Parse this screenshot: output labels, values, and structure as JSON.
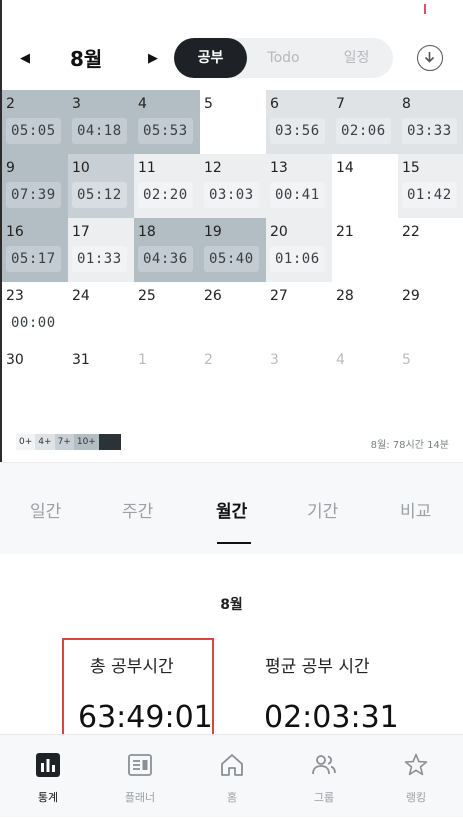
{
  "header": {
    "month_title": "8월",
    "prev_arrow": "◀",
    "next_arrow": "▶",
    "segments": [
      "공부",
      "Todo",
      "일정"
    ],
    "active_segment": "공부"
  },
  "calendar": {
    "weeks": [
      [
        {
          "num": "2",
          "time": "05:05",
          "level": 4
        },
        {
          "num": "3",
          "time": "04:18",
          "level": 4
        },
        {
          "num": "4",
          "time": "05:53",
          "level": 4
        },
        {
          "num": "5",
          "time": "",
          "level": 0
        },
        {
          "num": "6",
          "time": "03:56",
          "level": 2
        },
        {
          "num": "7",
          "time": "02:06",
          "level": 2
        },
        {
          "num": "8",
          "time": "03:33",
          "level": 2
        }
      ],
      [
        {
          "num": "9",
          "time": "07:39",
          "level": 4
        },
        {
          "num": "10",
          "time": "05:12",
          "level": 3
        },
        {
          "num": "11",
          "time": "02:20",
          "level": 1
        },
        {
          "num": "12",
          "time": "03:03",
          "level": 1
        },
        {
          "num": "13",
          "time": "00:41",
          "level": 1
        },
        {
          "num": "14",
          "time": "",
          "level": 0
        },
        {
          "num": "15",
          "time": "01:42",
          "level": 1
        }
      ],
      [
        {
          "num": "16",
          "time": "05:17",
          "level": 4
        },
        {
          "num": "17",
          "time": "01:33",
          "level": 1
        },
        {
          "num": "18",
          "time": "04:36",
          "level": 4
        },
        {
          "num": "19",
          "time": "05:40",
          "level": 4
        },
        {
          "num": "20",
          "time": "01:06",
          "level": 1
        },
        {
          "num": "21",
          "time": "",
          "level": 0
        },
        {
          "num": "22",
          "time": "",
          "level": 0
        }
      ],
      [
        {
          "num": "23",
          "time": "00:00",
          "level": 0
        },
        {
          "num": "24",
          "time": "",
          "level": 0
        },
        {
          "num": "25",
          "time": "",
          "level": 0
        },
        {
          "num": "26",
          "time": "",
          "level": 0
        },
        {
          "num": "27",
          "time": "",
          "level": 0
        },
        {
          "num": "28",
          "time": "",
          "level": 0
        },
        {
          "num": "29",
          "time": "",
          "level": 0
        }
      ],
      [
        {
          "num": "30",
          "time": "",
          "level": 0
        },
        {
          "num": "31",
          "time": "",
          "level": 0
        },
        {
          "num": "1",
          "time": "",
          "level": 0,
          "other": true
        },
        {
          "num": "2",
          "time": "",
          "level": 0,
          "other": true
        },
        {
          "num": "3",
          "time": "",
          "level": 0,
          "other": true
        },
        {
          "num": "4",
          "time": "",
          "level": 0,
          "other": true
        },
        {
          "num": "5",
          "time": "",
          "level": 0,
          "other": true
        }
      ]
    ]
  },
  "legend": {
    "items": [
      "0+",
      "4+",
      "7+",
      "10+"
    ],
    "total": "8월: 78시간 14분"
  },
  "tabs": {
    "items": [
      "일간",
      "주간",
      "월간",
      "기간",
      "비교"
    ],
    "active": "월간"
  },
  "stats": {
    "month": "8월",
    "total_label": "총 공부시간",
    "total_value": "63:49:01",
    "avg_label": "평균 공부 시간",
    "avg_value": "02:03:31"
  },
  "nav": {
    "items": [
      {
        "label": "통계",
        "icon": "bar-chart-icon"
      },
      {
        "label": "플래너",
        "icon": "planner-icon"
      },
      {
        "label": "홈",
        "icon": "home-icon"
      },
      {
        "label": "그룹",
        "icon": "group-icon"
      },
      {
        "label": "랭킹",
        "icon": "star-icon"
      }
    ],
    "active": "통계"
  },
  "colors": {
    "accent_dark": "#1e2226",
    "highlight_box": "#d9463b"
  }
}
